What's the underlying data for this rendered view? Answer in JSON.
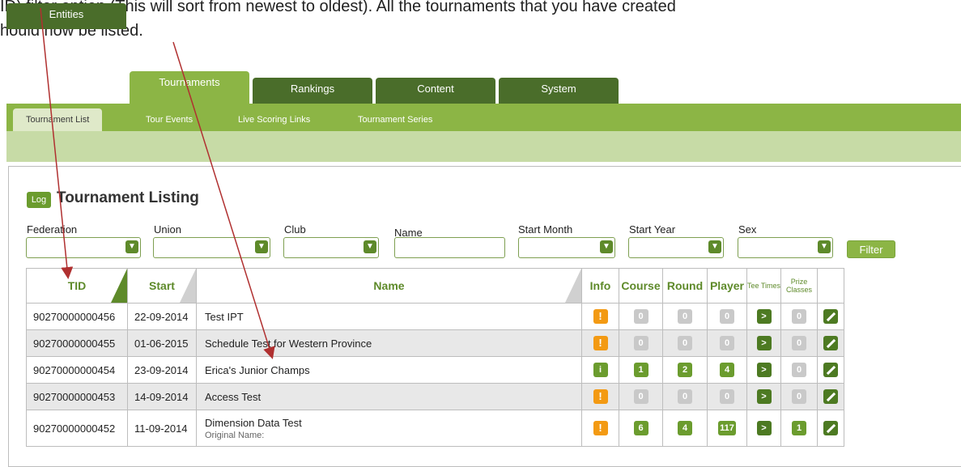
{
  "instructions": {
    "line1": "ID) filter option (This will sort from newest to oldest). All the tournaments that you have created",
    "line2": "hould now be listed."
  },
  "tabs": [
    "Entities",
    "Tournaments",
    "Rankings",
    "Content",
    "System"
  ],
  "active_tab": "Tournaments",
  "subtabs": [
    "Tournament List",
    "Tour Events",
    "Live Scoring Links",
    "Tournament Series"
  ],
  "active_subtab": "Tournament List",
  "panel": {
    "log_label": "Log",
    "title": "Tournament Listing"
  },
  "filters": {
    "federation": "Federation",
    "union": "Union",
    "club": "Club",
    "name": "Name",
    "start_month": "Start Month",
    "start_year": "Start Year",
    "sex": "Sex",
    "filter_button": "Filter"
  },
  "table": {
    "headers": {
      "tid": "TID",
      "start": "Start",
      "name": "Name",
      "info": "Info",
      "course": "Course",
      "round": "Round",
      "player": "Player",
      "tee_times": "Tee Times",
      "prize_classes": "Prize Classes"
    },
    "rows": [
      {
        "tid": "90270000000456",
        "start": "22-09-2014",
        "name": "Test IPT",
        "sub": "",
        "info": "!",
        "course": "0",
        "round": "0",
        "player": "0",
        "tee": ">",
        "prize": "0"
      },
      {
        "tid": "90270000000455",
        "start": "01-06-2015",
        "name": "Schedule Test for Western Province",
        "sub": "",
        "info": "!",
        "course": "0",
        "round": "0",
        "player": "0",
        "tee": ">",
        "prize": "0"
      },
      {
        "tid": "90270000000454",
        "start": "23-09-2014",
        "name": "Erica's Junior Champs",
        "sub": "",
        "info": "i",
        "course": "1",
        "round": "2",
        "player": "4",
        "tee": ">",
        "prize": "0"
      },
      {
        "tid": "90270000000453",
        "start": "14-09-2014",
        "name": "Access Test",
        "sub": "",
        "info": "!",
        "course": "0",
        "round": "0",
        "player": "0",
        "tee": ">",
        "prize": "0"
      },
      {
        "tid": "90270000000452",
        "start": "11-09-2014",
        "name": "Dimension Data Test",
        "sub": "Original Name:",
        "info": "!",
        "course": "6",
        "round": "4",
        "player": "117",
        "tee": ">",
        "prize": "1"
      }
    ]
  },
  "colors": {
    "tab_dark": "#4a6d2a",
    "tab_active": "#8cb545",
    "band": "#c7dba6",
    "badge_green": "#6b9c2e",
    "badge_orange": "#f39a13",
    "arrow": "#b03030"
  }
}
